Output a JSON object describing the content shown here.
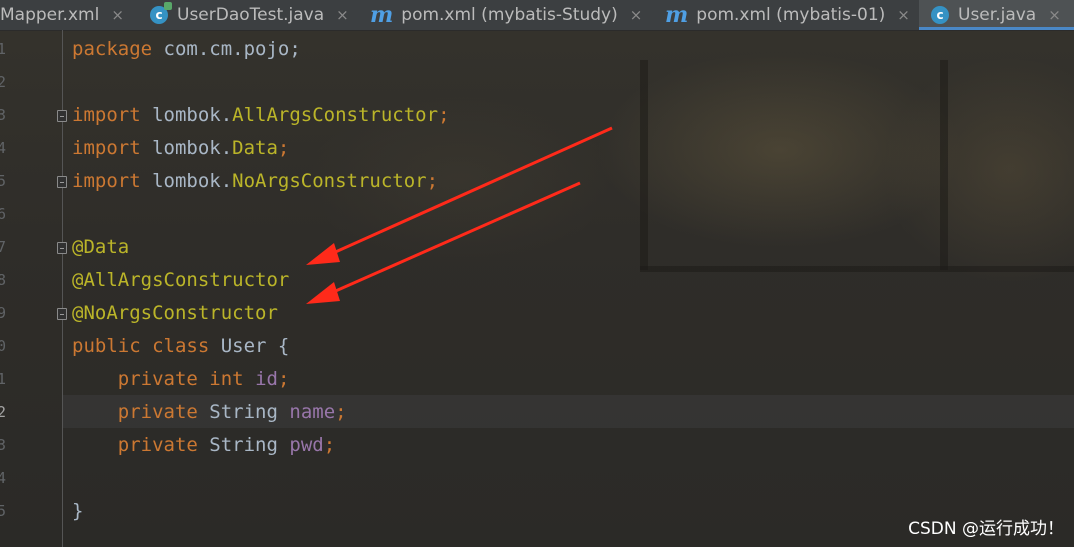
{
  "tabs": [
    {
      "label": "Mapper.xml",
      "icon": "none",
      "active": false
    },
    {
      "label": "UserDaoTest.java",
      "icon": "java-class-run-icon",
      "active": false
    },
    {
      "label": "pom.xml (mybatis-Study)",
      "icon": "maven-icon",
      "active": false
    },
    {
      "label": "pom.xml (mybatis-01)",
      "icon": "maven-icon",
      "active": false
    },
    {
      "label": "User.java",
      "icon": "java-class-icon",
      "active": true
    }
  ],
  "tab_close_glyph": "×",
  "icon_letters": {
    "maven": "m",
    "class": "c"
  },
  "gutter": {
    "line_numbers": [
      "1",
      "2",
      "3",
      "4",
      "5",
      "6",
      "7",
      "8",
      "9",
      "0",
      "1",
      "2",
      "3",
      "4",
      "5"
    ]
  },
  "code": {
    "package_kw": "package",
    "package_name": " com.cm.pojo;",
    "import_kw": "import",
    "imports": [
      {
        "pkg": " lombok.",
        "cls": "AllArgsConstructor",
        "end": ";"
      },
      {
        "pkg": " lombok.",
        "cls": "Data",
        "end": ";"
      },
      {
        "pkg": " lombok.",
        "cls": "NoArgsConstructor",
        "end": ";"
      }
    ],
    "annotations": [
      "@Data",
      "@AllArgsConstructor",
      "@NoArgsConstructor"
    ],
    "class_decl": {
      "public": "public",
      "class": "class",
      "name": " User {"
    },
    "fields": [
      {
        "mod": "private",
        "type_kw": "int",
        "type": "",
        "name": "id"
      },
      {
        "mod": "private",
        "type_kw": "",
        "type": "String",
        "name": "name"
      },
      {
        "mod": "private",
        "type_kw": "",
        "type": "String",
        "name": "pwd"
      }
    ],
    "closing_brace": "}"
  },
  "colors": {
    "keyword": "#cc7832",
    "annotation": "#bbb529",
    "field": "#9876aa",
    "plain": "#a9b7c6",
    "arrow": "#ff2a1a",
    "tab_accent": "#4a88c7"
  },
  "watermark": "CSDN @运行成功！"
}
